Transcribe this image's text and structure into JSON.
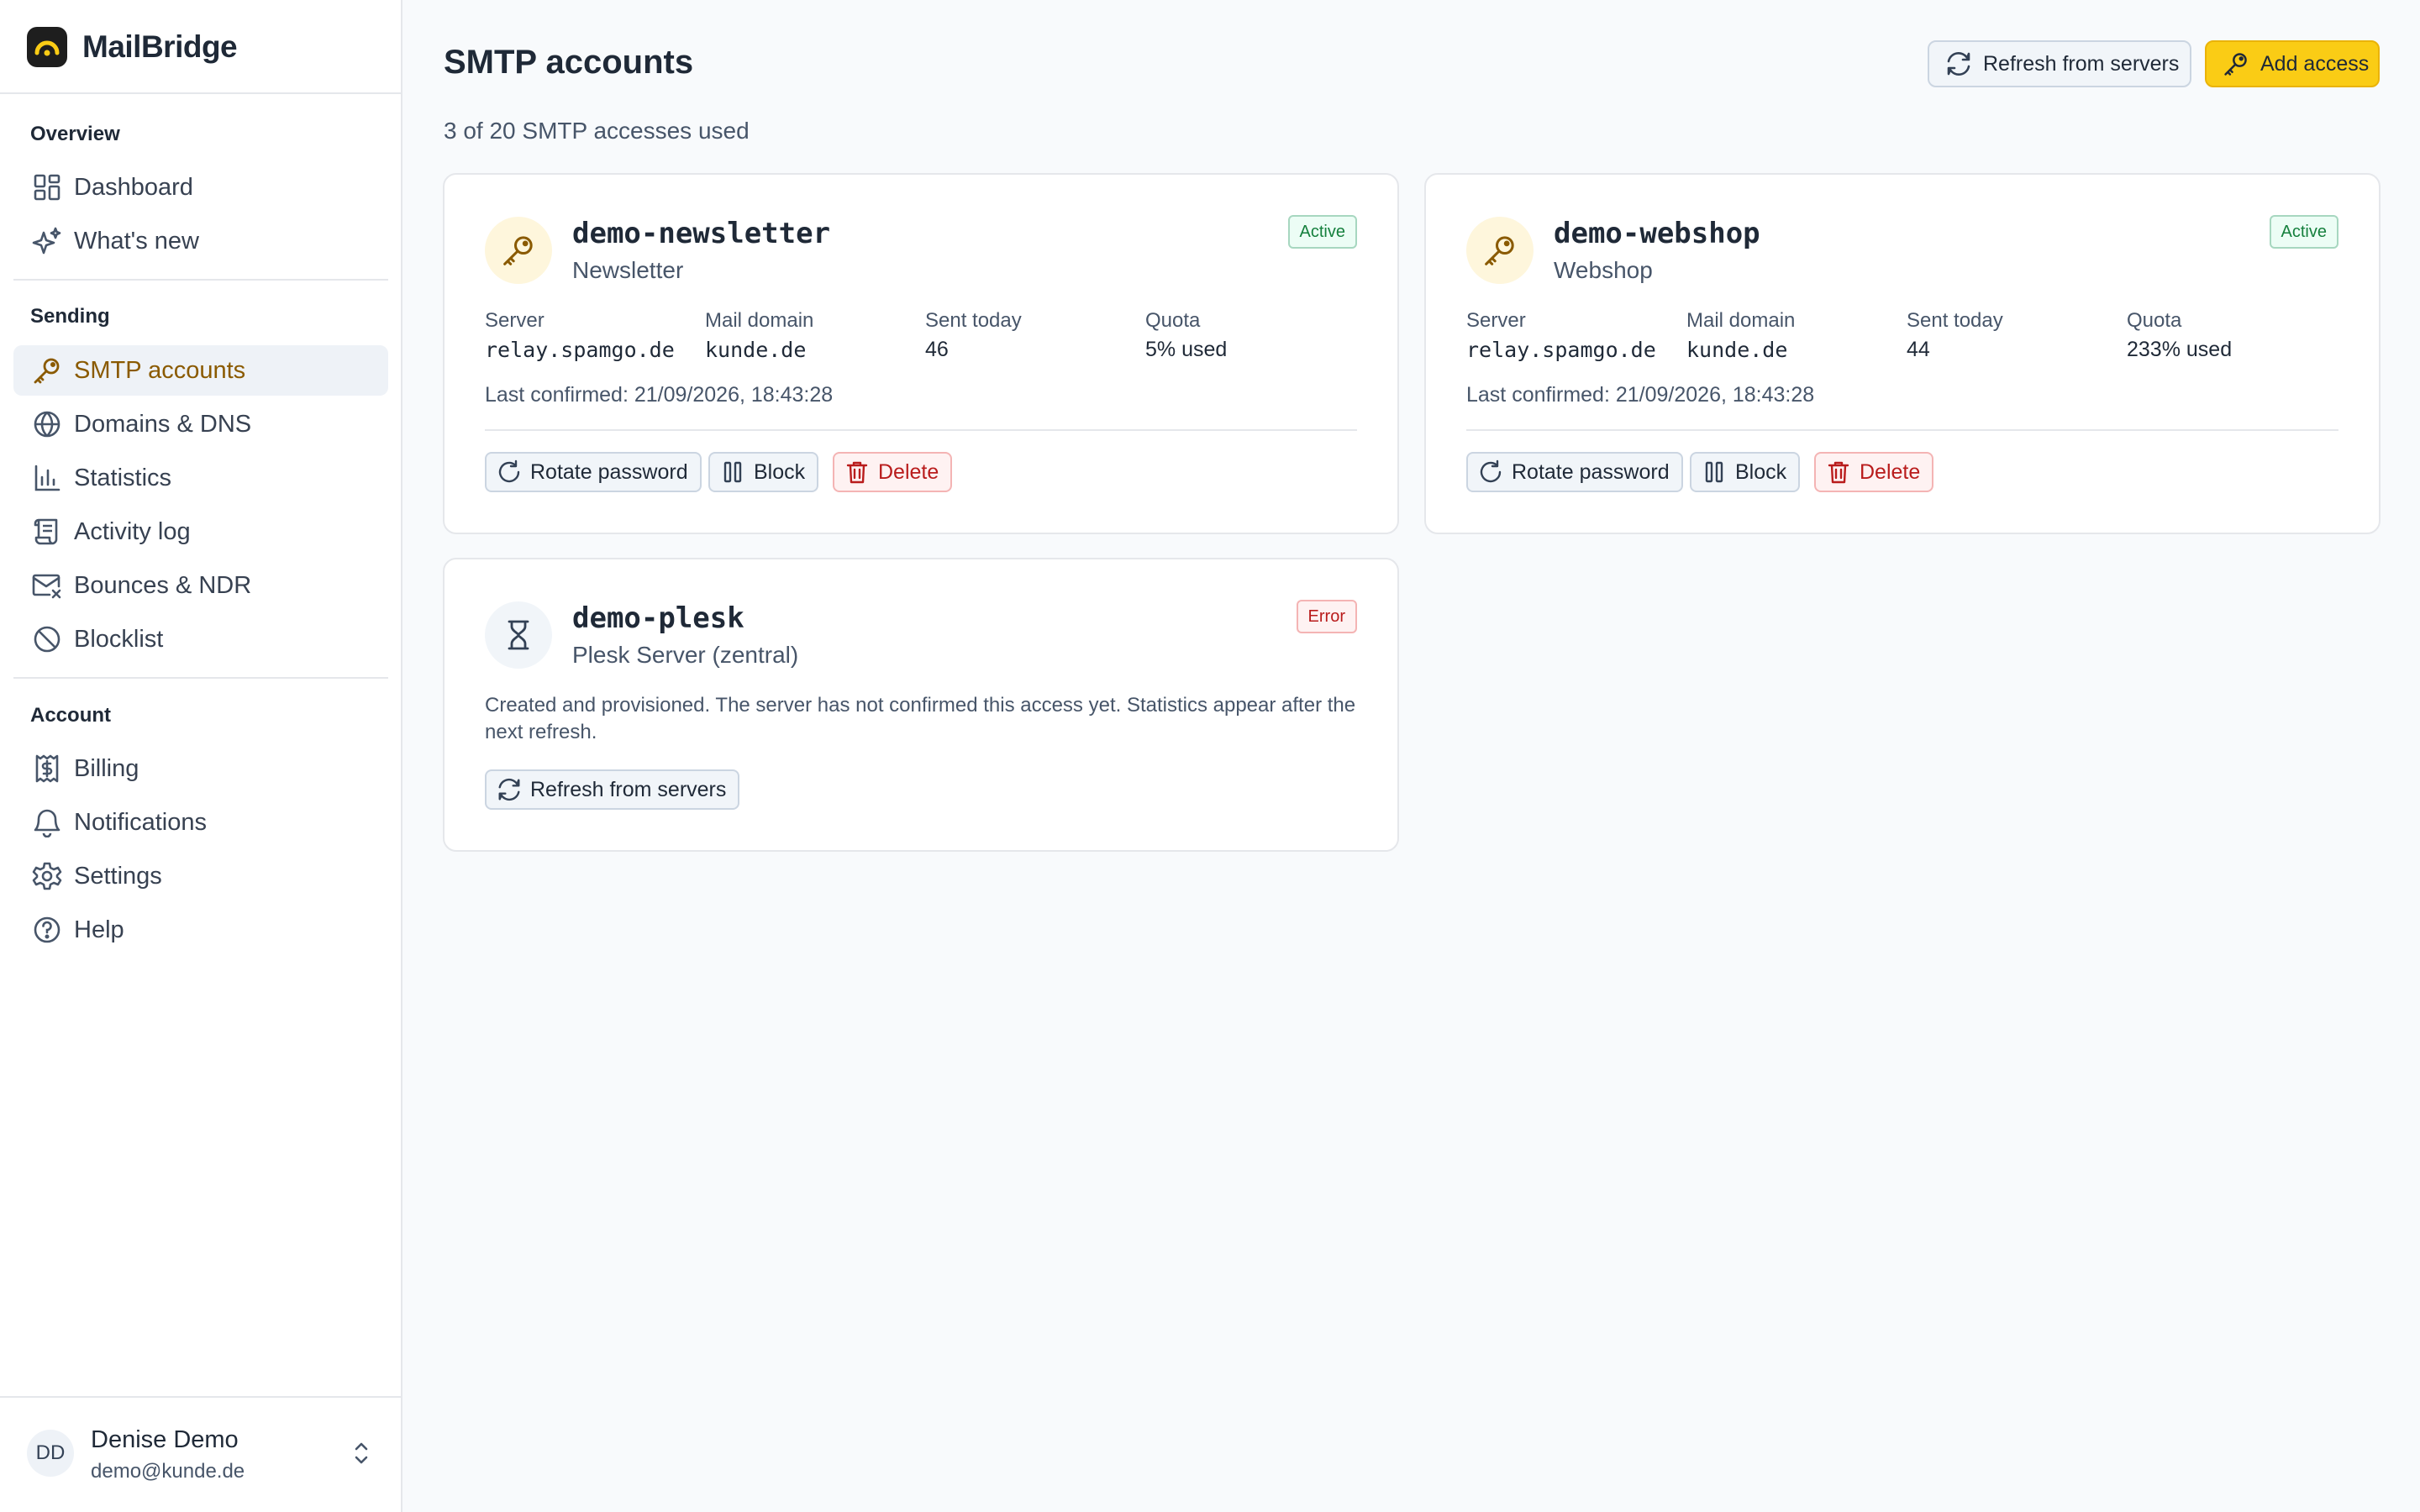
{
  "brand": {
    "name": "MailBridge"
  },
  "sidebar": {
    "sections": [
      {
        "heading": "Overview",
        "items": [
          {
            "label": "Dashboard",
            "icon": "dashboard-icon"
          },
          {
            "label": "What's new",
            "icon": "sparkles-icon"
          }
        ]
      },
      {
        "heading": "Sending",
        "items": [
          {
            "label": "SMTP accounts",
            "icon": "key-icon",
            "active": true
          },
          {
            "label": "Domains & DNS",
            "icon": "globe-icon"
          },
          {
            "label": "Statistics",
            "icon": "bar-chart-icon"
          },
          {
            "label": "Activity log",
            "icon": "scroll-icon"
          },
          {
            "label": "Bounces & NDR",
            "icon": "mail-x-icon"
          },
          {
            "label": "Blocklist",
            "icon": "ban-icon"
          }
        ]
      },
      {
        "heading": "Account",
        "items": [
          {
            "label": "Billing",
            "icon": "receipt-icon"
          },
          {
            "label": "Notifications",
            "icon": "bell-icon"
          },
          {
            "label": "Settings",
            "icon": "gear-icon"
          },
          {
            "label": "Help",
            "icon": "help-circle-icon"
          }
        ]
      }
    ],
    "user": {
      "initials": "DD",
      "name": "Denise Demo",
      "email": "demo@kunde.de"
    }
  },
  "header": {
    "title": "SMTP accounts",
    "subtitle": "3 of 20 SMTP accesses used",
    "refresh_label": "Refresh from servers",
    "add_label": "Add access"
  },
  "labels": {
    "server": "Server",
    "mail_domain": "Mail domain",
    "sent_today": "Sent today",
    "quota": "Quota",
    "rotate": "Rotate password",
    "block": "Block",
    "delete": "Delete",
    "refresh": "Refresh from servers"
  },
  "accounts": [
    {
      "name": "demo-newsletter",
      "description": "Newsletter",
      "status": "Active",
      "server": "relay.spamgo.de",
      "mail_domain": "kunde.de",
      "sent_today": "46",
      "quota": "5% used",
      "last_confirmed": "Last confirmed: 21/09/2026, 18:43:28"
    },
    {
      "name": "demo-webshop",
      "description": "Webshop",
      "status": "Active",
      "server": "relay.spamgo.de",
      "mail_domain": "kunde.de",
      "sent_today": "44",
      "quota": "233% used",
      "last_confirmed": "Last confirmed: 21/09/2026, 18:43:28"
    },
    {
      "name": "demo-plesk",
      "description": "Plesk Server (zentral)",
      "status": "Error",
      "message": "Created and provisioned. The server has not confirmed this access yet. Statistics appear after the next refresh."
    }
  ],
  "colors": {
    "accent": "#facc15",
    "active_nav_text": "#8a5a00",
    "success": "#15803d",
    "danger": "#b91c1c"
  }
}
